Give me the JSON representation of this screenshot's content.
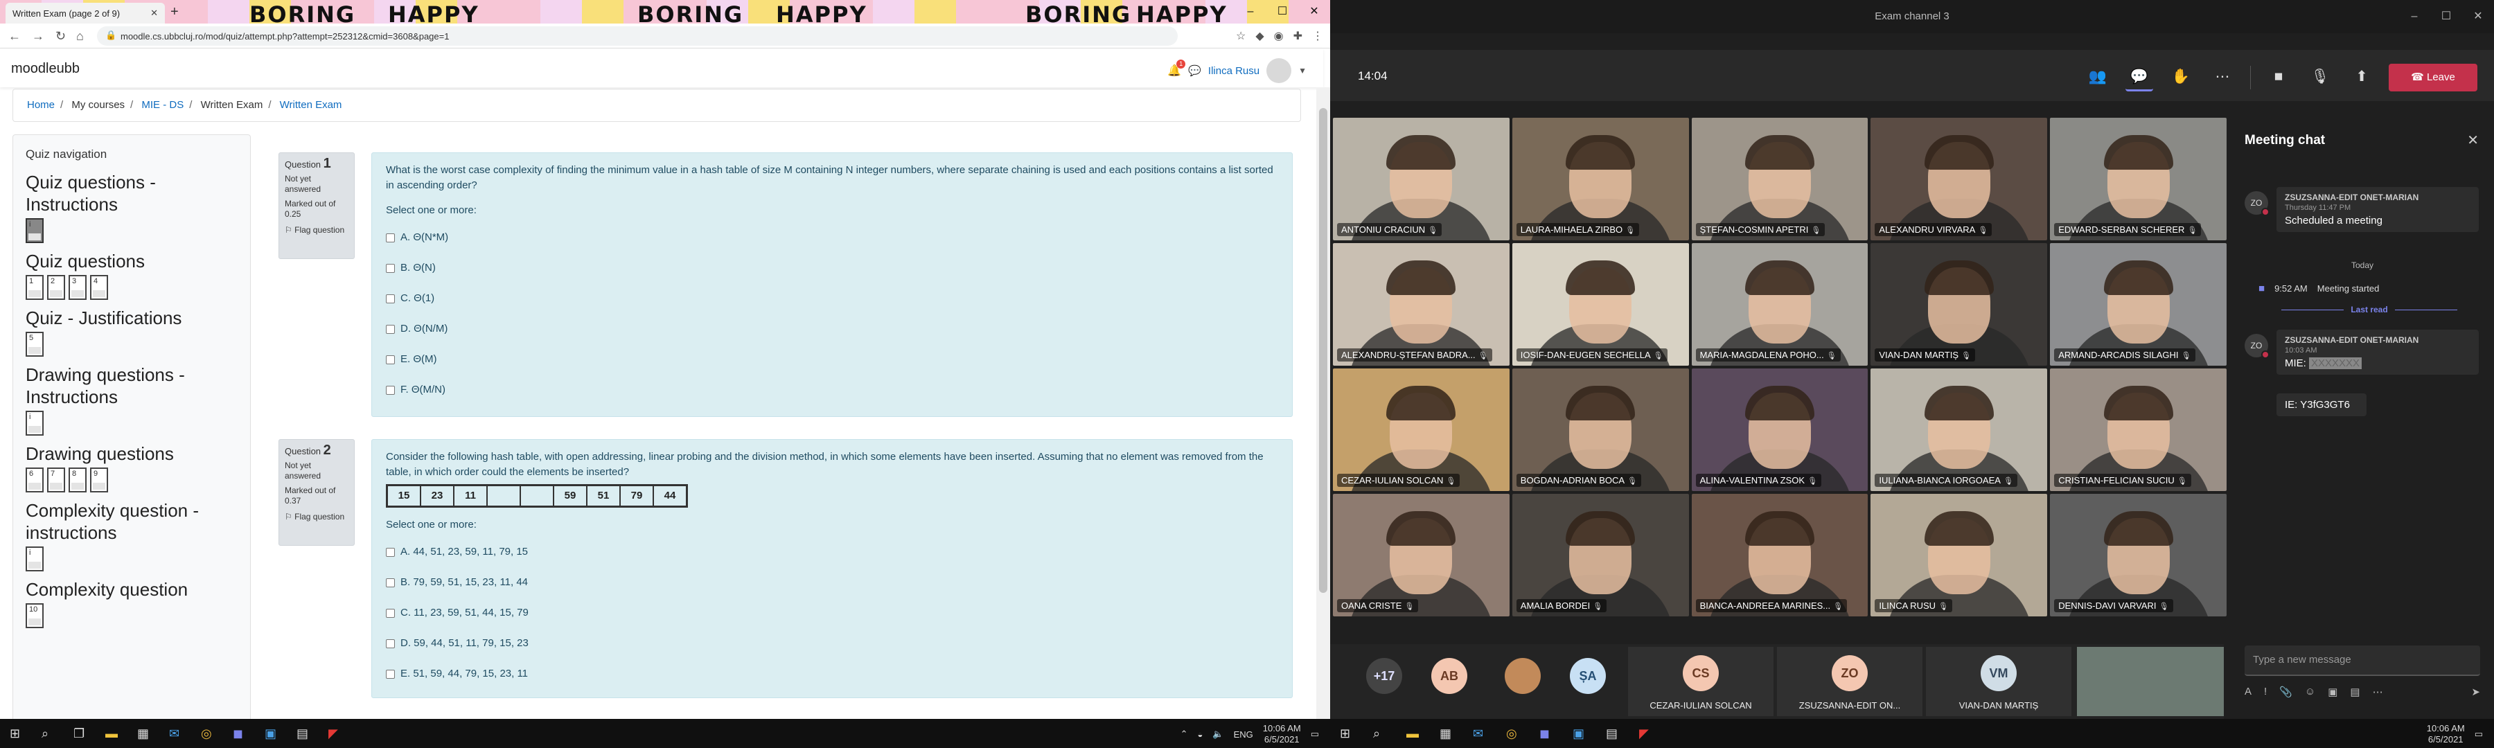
{
  "browser": {
    "tab_title": "Written Exam (page 2 of 9)",
    "banner_words": [
      "BORING",
      "HAPPY",
      "BORING",
      "HAPPY",
      "BORING",
      "HAPPY"
    ],
    "url": "moodle.cs.ubbcluj.ro/mod/quiz/attempt.php?attempt=252312&cmid=3608&page=1"
  },
  "moodle": {
    "brand": "moodleubb",
    "user_name": "Ilinca Rusu",
    "notification_count": "1",
    "breadcrumb": [
      "Home",
      "My courses",
      "MIE - DS",
      "Written Exam",
      "Written Exam"
    ]
  },
  "quiz_nav": {
    "title": "Quiz navigation",
    "sections": [
      {
        "name": "Quiz questions - Instructions",
        "buttons": [
          "i"
        ]
      },
      {
        "name": "Quiz questions",
        "buttons": [
          "1",
          "2",
          "3",
          "4"
        ]
      },
      {
        "name": "Quiz - Justifications",
        "buttons": [
          "5"
        ]
      },
      {
        "name": "Drawing questions - Instructions",
        "buttons": [
          "i"
        ]
      },
      {
        "name": "Drawing questions",
        "buttons": [
          "6",
          "7",
          "8",
          "9"
        ]
      },
      {
        "name": "Complexity question - instructions",
        "buttons": [
          "i"
        ]
      },
      {
        "name": "Complexity question",
        "buttons": [
          "10"
        ]
      }
    ]
  },
  "questions": [
    {
      "label": "Question",
      "number": "1",
      "status": "Not yet answered",
      "marks": "Marked out of 0.25",
      "flag": "Flag question",
      "text": "What is the worst case complexity of finding the minimum value in a hash table of size M containing N integer numbers, where separate chaining is used and each positions contains a list sorted in ascending order?",
      "prompt": "Select one or more:",
      "options": [
        "A. Θ(N*M)",
        "B. Θ(N)",
        "C. Θ(1)",
        "D. Θ(N/M)",
        "E. Θ(M)",
        "F. Θ(M/N)"
      ]
    },
    {
      "label": "Question",
      "number": "2",
      "status": "Not yet answered",
      "marks": "Marked out of 0.37",
      "flag": "Flag question",
      "text": "Consider the following hash table, with open addressing, linear probing and the division method, in which some elements have been inserted. Assuming that no element was removed from the table, in which order could the elements be inserted?",
      "table": [
        "15",
        "23",
        "11",
        "",
        "",
        "59",
        "51",
        "79",
        "44"
      ],
      "prompt": "Select one or more:",
      "options": [
        "A. 44, 51, 23, 59, 11, 79, 15",
        "B. 79, 59, 51, 15, 23, 11, 44",
        "C. 11, 23, 59, 51, 44, 15, 79",
        "D. 59, 44, 51, 11, 79, 15, 23",
        "E. 51, 59, 44, 79, 15, 23, 11"
      ]
    }
  ],
  "taskbar_left": {
    "lang": "ENG",
    "time": "10:06 AM",
    "date": "6/5/2021"
  },
  "teams": {
    "window_title": "Exam channel 3",
    "timer": "14:04",
    "leave_label": "Leave",
    "accent": "#7b83eb",
    "participants": [
      "ANTONIU CRACIUN",
      "LAURA-MIHAELA ZIRBO",
      "ȘTEFAN-COSMIN APETRI",
      "ALEXANDRU VIRVARA",
      "EDWARD-SERBAN SCHERER",
      "ALEXANDRU-ȘTEFAN BADRA...",
      "IOSIF-DAN-EUGEN SECHELLA",
      "MARIA-MAGDALENA POHO...",
      "VIAN-DAN MARTIȘ",
      "ARMAND-ARCADIS SILAGHI",
      "CEZAR-IULIAN SOLCAN",
      "BOGDAN-ADRIAN BOCA",
      "ALINA-VALENTINA ZSOK",
      "IULIANA-BIANCA IORGOAEA",
      "CRISTIAN-FELICIAN SUCIU",
      "OANA CRISTE",
      "AMALIA BORDEI",
      "BIANCA-ANDREEA MARINES...",
      "ILINCA RUSU",
      "DENNIS-DAVI VARVARI"
    ],
    "strip": {
      "overflow": "+17",
      "avatars": [
        "AB",
        "ȘA"
      ],
      "tiles": [
        {
          "initials": "CS",
          "name": "CEZAR-IULIAN SOLCAN"
        },
        {
          "initials": "ZO",
          "name": "ZSUZSANNA-EDIT ON..."
        },
        {
          "initials": "VM",
          "name": "VIAN-DAN MARTIȘ"
        }
      ]
    },
    "chat": {
      "title": "Meeting chat",
      "msg1": {
        "initials": "ZO",
        "author": "ZSUZSANNA-EDIT ONET-MARIAN",
        "time": "Thursday 11:47 PM",
        "text": "Scheduled a meeting"
      },
      "today": "Today",
      "meeting_time": "9:52 AM",
      "meeting_text": "Meeting started",
      "last_read": "Last read",
      "msg2": {
        "initials": "ZO",
        "author": "ZSUZSANNA-EDIT ONET-MARIAN",
        "time": "10:03 AM",
        "text": "MIE:",
        "redacted": "XXXXXXX"
      },
      "msg3": "IE: Y3fG3GT6",
      "compose_placeholder": "Type a new message"
    }
  },
  "taskbar_right": {
    "time": "10:06 AM",
    "date": "6/5/2021"
  }
}
